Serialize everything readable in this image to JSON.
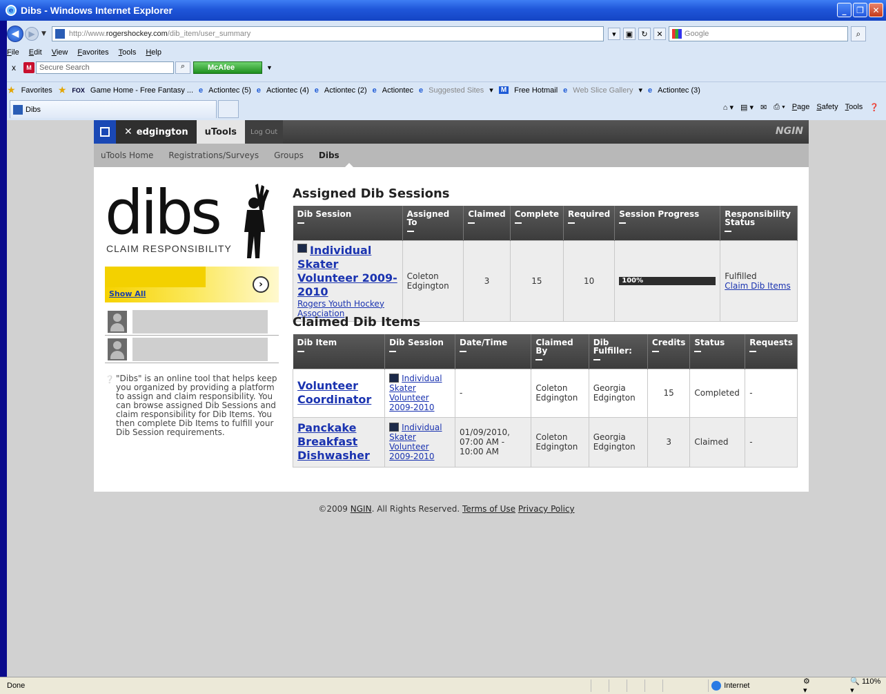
{
  "window": {
    "title": "Dibs - Windows Internet Explorer"
  },
  "address": {
    "prefix": "http://www.",
    "domain": "rogershockey.com",
    "path": "/dib_item/user_summary"
  },
  "search": {
    "placeholder": "Google"
  },
  "menu": [
    "File",
    "Edit",
    "View",
    "Favorites",
    "Tools",
    "Help"
  ],
  "toolbar": {
    "secure_search": "Secure Search",
    "mcafee": "McAfee"
  },
  "favorites": {
    "label": "Favorites",
    "items": [
      "Game Home - Free Fantasy ...",
      "Actiontec (5)",
      "Actiontec (4)",
      "Actiontec (2)",
      "Actiontec",
      "Suggested Sites",
      "Free Hotmail",
      "Web Slice Gallery",
      "Actiontec (3)"
    ]
  },
  "tab": {
    "label": "Dibs"
  },
  "commands": [
    "Page",
    "Safety",
    "Tools"
  ],
  "site": {
    "user": "edgington",
    "utools": "uTools",
    "logout": "Log Out",
    "brand": "NGIN",
    "subnav": [
      "uTools Home",
      "Registrations/Surveys",
      "Groups",
      "Dibs"
    ]
  },
  "sidebar": {
    "logo_word": "dibs",
    "tagline": "CLAIM RESPONSIBILITY",
    "show_all": "Show All",
    "info": "\"Dibs\" is an online tool that helps keep you organized by providing a platform to assign and claim responsibility. You can browse assigned Dib Sessions and claim responsibility for Dib Items. You then complete Dib Items to fulfill your Dib Session requirements."
  },
  "assigned": {
    "heading": "Assigned Dib Sessions",
    "headers": [
      "Dib Session",
      "Assigned To",
      "Claimed",
      "Complete",
      "Required",
      "Session Progress",
      "Responsibility Status"
    ],
    "row": {
      "session": "Individual Skater Volunteer 2009-2010",
      "org": "Rogers Youth Hockey Association",
      "assigned_to": "Coleton Edgington",
      "claimed": "3",
      "complete": "15",
      "required": "10",
      "progress": "100%",
      "progress_value": 1.0,
      "status": "Fulfilled",
      "status_link": "Claim Dib Items"
    }
  },
  "claimed": {
    "heading": "Claimed Dib Items",
    "headers": [
      "Dib Item",
      "Dib Session",
      "Date/Time",
      "Claimed By",
      "Dib Fulfiller:",
      "Credits",
      "Status",
      "Requests"
    ],
    "rows": [
      {
        "item": "Volunteer Coordinator",
        "session": "Individual Skater Volunteer 2009-2010",
        "datetime": "-",
        "claimed_by": "Coleton Edgington",
        "fulfiller": "Georgia Edgington",
        "credits": "15",
        "status": "Completed",
        "requests": "-"
      },
      {
        "item": "Panckake Breakfast Dishwasher",
        "session": "Individual Skater Volunteer 2009-2010",
        "datetime": "01/09/2010, 07:00 AM - 10:00 AM",
        "claimed_by": "Coleton Edgington",
        "fulfiller": "Georgia Edgington",
        "credits": "3",
        "status": "Claimed",
        "requests": "-"
      }
    ]
  },
  "footer": {
    "copyright": "©2009",
    "ngin": "NGIN",
    "rights": ". All Rights Reserved.",
    "terms": "Terms of Use",
    "privacy": "Privacy Policy"
  },
  "status": {
    "left": "Done",
    "zone": "Internet",
    "zoom": "110%"
  }
}
